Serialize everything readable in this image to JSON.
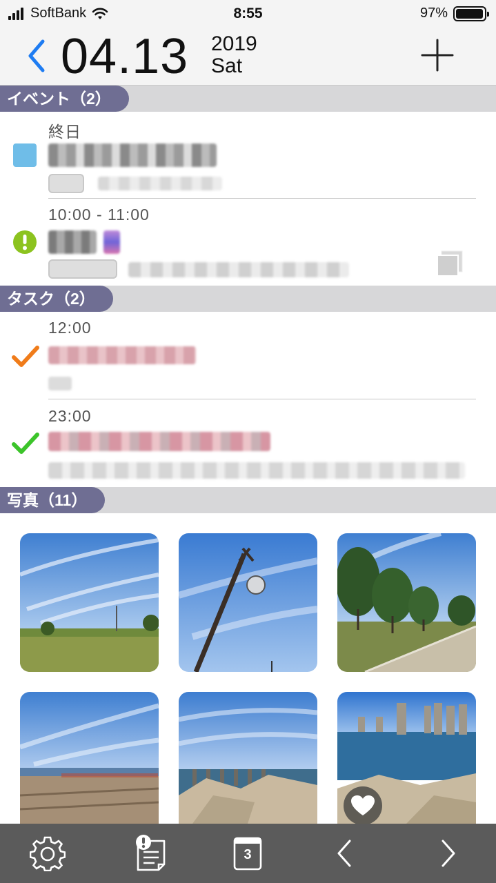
{
  "status_bar": {
    "carrier": "SoftBank",
    "time": "8:55",
    "battery_percent": "97%",
    "battery_level": 0.97,
    "signal_bars": 4
  },
  "header": {
    "date": "04.13",
    "year": "2019",
    "weekday": "Sat",
    "back_icon": "chevron-left-icon",
    "add_icon": "plus-icon"
  },
  "events": {
    "title": "イベント（2）",
    "items": [
      {
        "time": "終日",
        "color": "#6fbde8",
        "icon": "calendar-color-square"
      },
      {
        "time": "10:00 - 11:00",
        "color": "#8cc31f",
        "icon": "exclamation-circle-icon"
      }
    ]
  },
  "tasks": {
    "title": "タスク（2）",
    "items": [
      {
        "time": "12:00",
        "check_color": "#f07c1a"
      },
      {
        "time": "23:00",
        "check_color": "#3cc42a"
      }
    ]
  },
  "photos": {
    "title": "写真（11）",
    "count_visible": 6
  },
  "toolbar": {
    "items": [
      "gear-icon",
      "memo-alert-icon",
      "calendar-day-icon",
      "chevron-left-icon",
      "chevron-right-icon"
    ],
    "calendar_day": "3"
  },
  "colors": {
    "accent_blue": "#1e7cf2",
    "section_tab": "#6f6e93",
    "section_bar": "#d7d7d9",
    "toolbar_bg": "#5b5b5b"
  }
}
